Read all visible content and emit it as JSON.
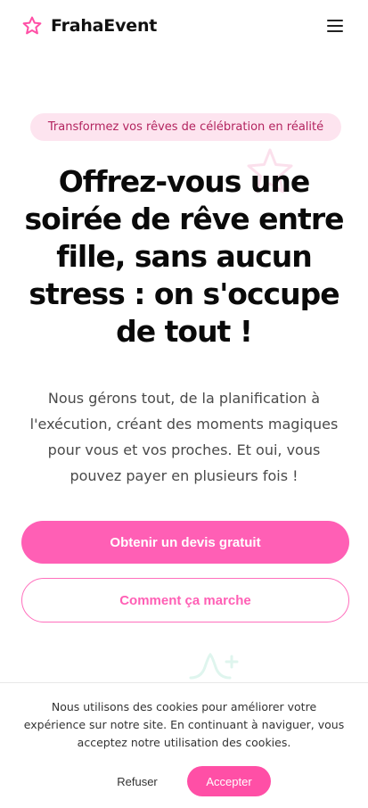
{
  "header": {
    "brand_name": "FrahaEvent",
    "brand_icon": "star-outline-icon",
    "menu_icon": "hamburger-menu-icon"
  },
  "hero": {
    "badge": "Transformez vos rêves de célébration en réalité",
    "title_lines": [
      "Offrez-vous une",
      "soirée de rêve entre",
      "fille, sans aucun",
      "stress : on s'occupe",
      "de tout !"
    ],
    "subtitle_lines": [
      "Nous gérons tout, de la planification à",
      "l'exécution, créant des moments magiques",
      "pour vous et vos proches. Et oui, vous",
      "pouvez payer en plusieurs fois !"
    ],
    "primary_cta": "Obtenir un devis gratuit",
    "secondary_cta": "Comment ça marche"
  },
  "cookie_banner": {
    "text_lines": [
      "Nous utilisons des cookies pour améliorer votre",
      "expérience sur notre site. En continuant à naviguer, vous",
      "acceptez notre utilisation des cookies."
    ],
    "refuse_label": "Refuser",
    "accept_label": "Accepter"
  },
  "colors": {
    "accent": "#ff5fb5",
    "badge_bg": "#fde4ef",
    "badge_text": "#b3245f",
    "text_dark": "#0a0a0a",
    "text_muted": "#4a4a4a"
  }
}
